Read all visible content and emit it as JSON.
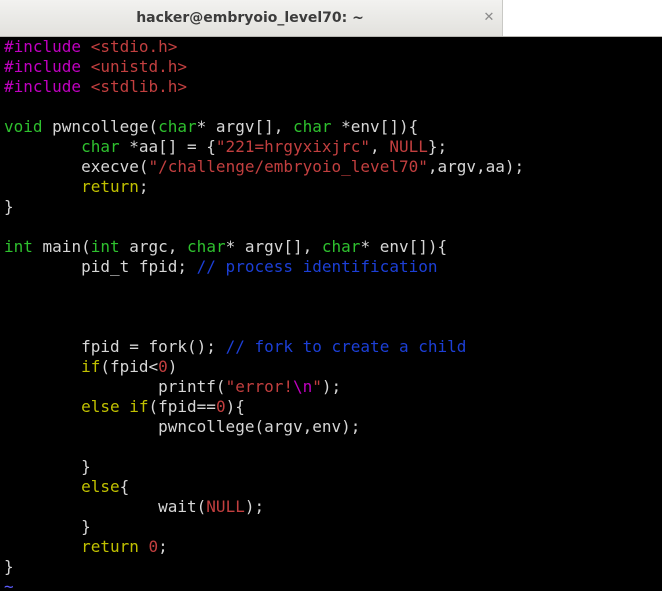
{
  "window": {
    "title": "hacker@embryoio_level70: ~",
    "close_glyph": "✕"
  },
  "editor": {
    "empty_line_marker": "~",
    "colors": {
      "text": "#d6d6d6",
      "preproc": "#c000c0",
      "type": "#2ec02e",
      "string": "#c23f3f",
      "special": "#c000c0",
      "keyword": "#c0c000",
      "comment": "#1c3fd6",
      "number": "#c23f3f",
      "brace": "#d6d6d6"
    },
    "lines": [
      [
        {
          "t": "#include ",
          "c": "preproc"
        },
        {
          "t": "<stdio.h>",
          "c": "string"
        }
      ],
      [
        {
          "t": "#include ",
          "c": "preproc"
        },
        {
          "t": "<unistd.h>",
          "c": "string"
        }
      ],
      [
        {
          "t": "#include ",
          "c": "preproc"
        },
        {
          "t": "<stdlib.h>",
          "c": "string"
        }
      ],
      [],
      [
        {
          "t": "void",
          "c": "type"
        },
        {
          "t": " pwncollege(",
          "c": "text"
        },
        {
          "t": "char",
          "c": "type"
        },
        {
          "t": "* argv[], ",
          "c": "text"
        },
        {
          "t": "char",
          "c": "type"
        },
        {
          "t": " *env[]){",
          "c": "text"
        }
      ],
      [
        {
          "t": "        ",
          "c": "text"
        },
        {
          "t": "char",
          "c": "type"
        },
        {
          "t": " *aa[] = {",
          "c": "text"
        },
        {
          "t": "\"221=hrgyxixjrc\"",
          "c": "string"
        },
        {
          "t": ", ",
          "c": "text"
        },
        {
          "t": "NULL",
          "c": "string"
        },
        {
          "t": "};",
          "c": "text"
        }
      ],
      [
        {
          "t": "        execve(",
          "c": "text"
        },
        {
          "t": "\"/challenge/embryoio_level70\"",
          "c": "string"
        },
        {
          "t": ",argv,aa);",
          "c": "text"
        }
      ],
      [
        {
          "t": "        ",
          "c": "text"
        },
        {
          "t": "return",
          "c": "keyword"
        },
        {
          "t": ";",
          "c": "text"
        }
      ],
      [
        {
          "t": "}",
          "c": "text"
        }
      ],
      [],
      [
        {
          "t": "int",
          "c": "type"
        },
        {
          "t": " main(",
          "c": "text"
        },
        {
          "t": "int",
          "c": "type"
        },
        {
          "t": " argc, ",
          "c": "text"
        },
        {
          "t": "char",
          "c": "type"
        },
        {
          "t": "* argv[], ",
          "c": "text"
        },
        {
          "t": "char",
          "c": "type"
        },
        {
          "t": "* env[]){",
          "c": "text"
        }
      ],
      [
        {
          "t": "        pid_t fpid; ",
          "c": "text"
        },
        {
          "t": "// process identification",
          "c": "comment"
        }
      ],
      [],
      [],
      [],
      [
        {
          "t": "        fpid = fork(); ",
          "c": "text"
        },
        {
          "t": "// fork to create a child",
          "c": "comment"
        }
      ],
      [
        {
          "t": "        ",
          "c": "text"
        },
        {
          "t": "if",
          "c": "keyword"
        },
        {
          "t": "(fpid<",
          "c": "text"
        },
        {
          "t": "0",
          "c": "number"
        },
        {
          "t": ")",
          "c": "text"
        }
      ],
      [
        {
          "t": "                printf(",
          "c": "text"
        },
        {
          "t": "\"error!",
          "c": "string"
        },
        {
          "t": "\\n",
          "c": "special"
        },
        {
          "t": "\"",
          "c": "string"
        },
        {
          "t": ");",
          "c": "text"
        }
      ],
      [
        {
          "t": "        ",
          "c": "text"
        },
        {
          "t": "else",
          "c": "keyword"
        },
        {
          "t": " ",
          "c": "text"
        },
        {
          "t": "if",
          "c": "keyword"
        },
        {
          "t": "(fpid==",
          "c": "text"
        },
        {
          "t": "0",
          "c": "number"
        },
        {
          "t": "){",
          "c": "text"
        }
      ],
      [
        {
          "t": "                pwncollege(argv,env);",
          "c": "text"
        }
      ],
      [],
      [
        {
          "t": "        }",
          "c": "text"
        }
      ],
      [
        {
          "t": "        ",
          "c": "text"
        },
        {
          "t": "else",
          "c": "keyword"
        },
        {
          "t": "{",
          "c": "text"
        }
      ],
      [
        {
          "t": "                wait(",
          "c": "text"
        },
        {
          "t": "NULL",
          "c": "string"
        },
        {
          "t": ");",
          "c": "text"
        }
      ],
      [
        {
          "t": "        }",
          "c": "text"
        }
      ],
      [
        {
          "t": "        ",
          "c": "text"
        },
        {
          "t": "return",
          "c": "keyword"
        },
        {
          "t": " ",
          "c": "text"
        },
        {
          "t": "0",
          "c": "number"
        },
        {
          "t": ";",
          "c": "text"
        }
      ],
      [
        {
          "t": "}",
          "c": "text"
        }
      ]
    ]
  }
}
